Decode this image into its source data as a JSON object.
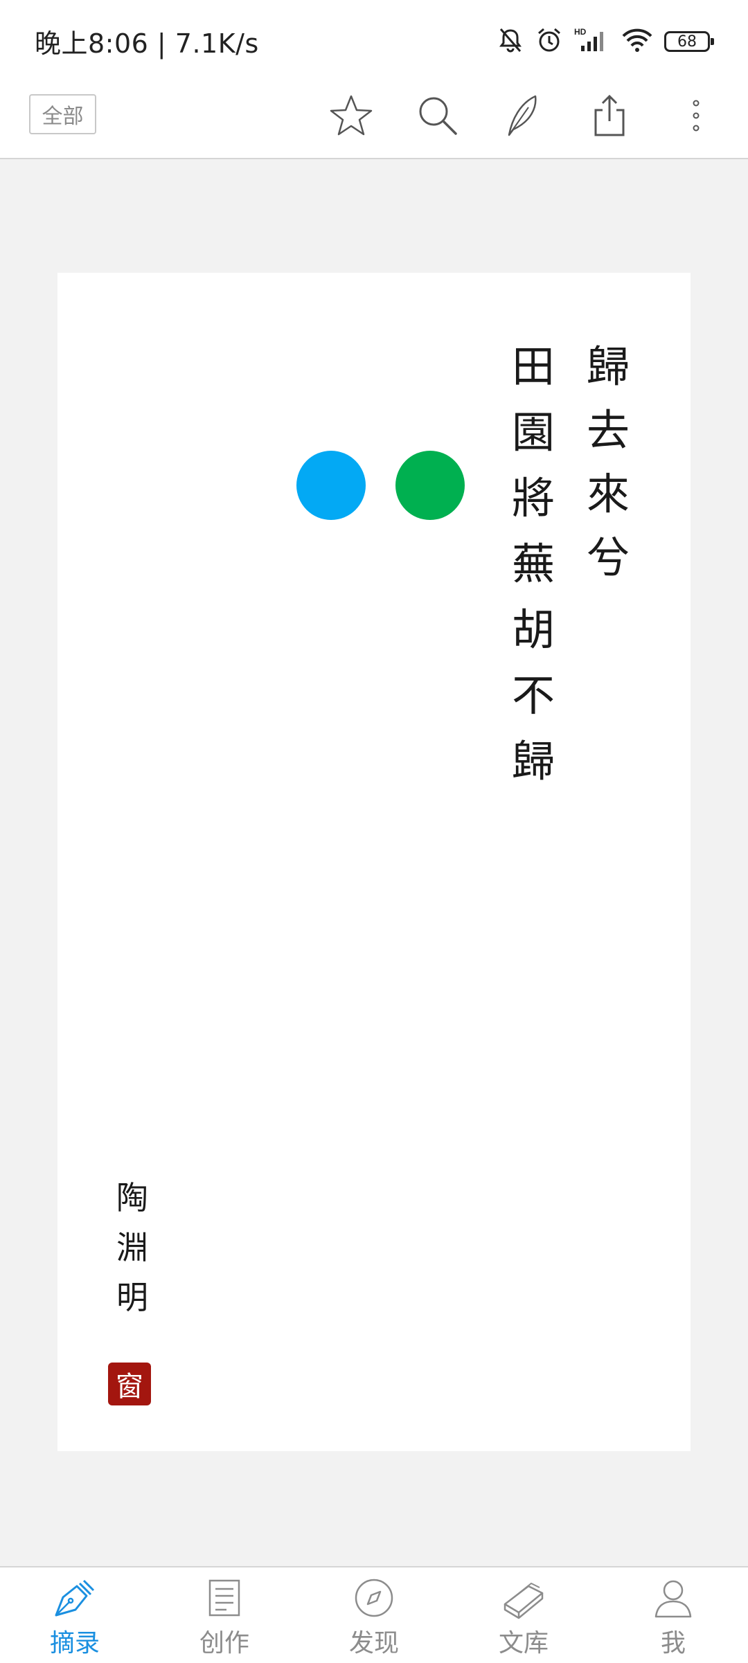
{
  "status_bar": {
    "time_and_speed": "晚上8:06 | 7.1K/s",
    "battery_level": "68",
    "icons": [
      "mute-bell-icon",
      "alarm-icon",
      "hd-signal-icon",
      "wifi-icon",
      "battery-icon"
    ]
  },
  "toolbar": {
    "filter_label": "全部",
    "icons": [
      "star-icon",
      "search-icon",
      "feather-icon",
      "share-icon",
      "more-icon"
    ]
  },
  "card": {
    "poem_columns": [
      [
        "歸",
        "去",
        "來",
        "兮"
      ],
      [
        "田",
        "園",
        "將",
        "蕪",
        "胡",
        "不",
        "歸"
      ]
    ],
    "author_chars": [
      "陶",
      "淵",
      "明"
    ],
    "seal_char": "窗",
    "dot_colors": [
      "#03a9f4",
      "#00b050"
    ],
    "seal_color": "#a3160f"
  },
  "bottom_nav": {
    "items": [
      {
        "label": "摘录",
        "icon": "pen-nib-icon",
        "active": true
      },
      {
        "label": "创作",
        "icon": "document-icon",
        "active": false
      },
      {
        "label": "发现",
        "icon": "compass-icon",
        "active": false
      },
      {
        "label": "文库",
        "icon": "books-icon",
        "active": false
      },
      {
        "label": "我",
        "icon": "person-icon",
        "active": false
      }
    ]
  },
  "colors": {
    "accent": "#1a8fe0",
    "inactive": "#8c8c8c",
    "background": "#f2f2f2"
  }
}
